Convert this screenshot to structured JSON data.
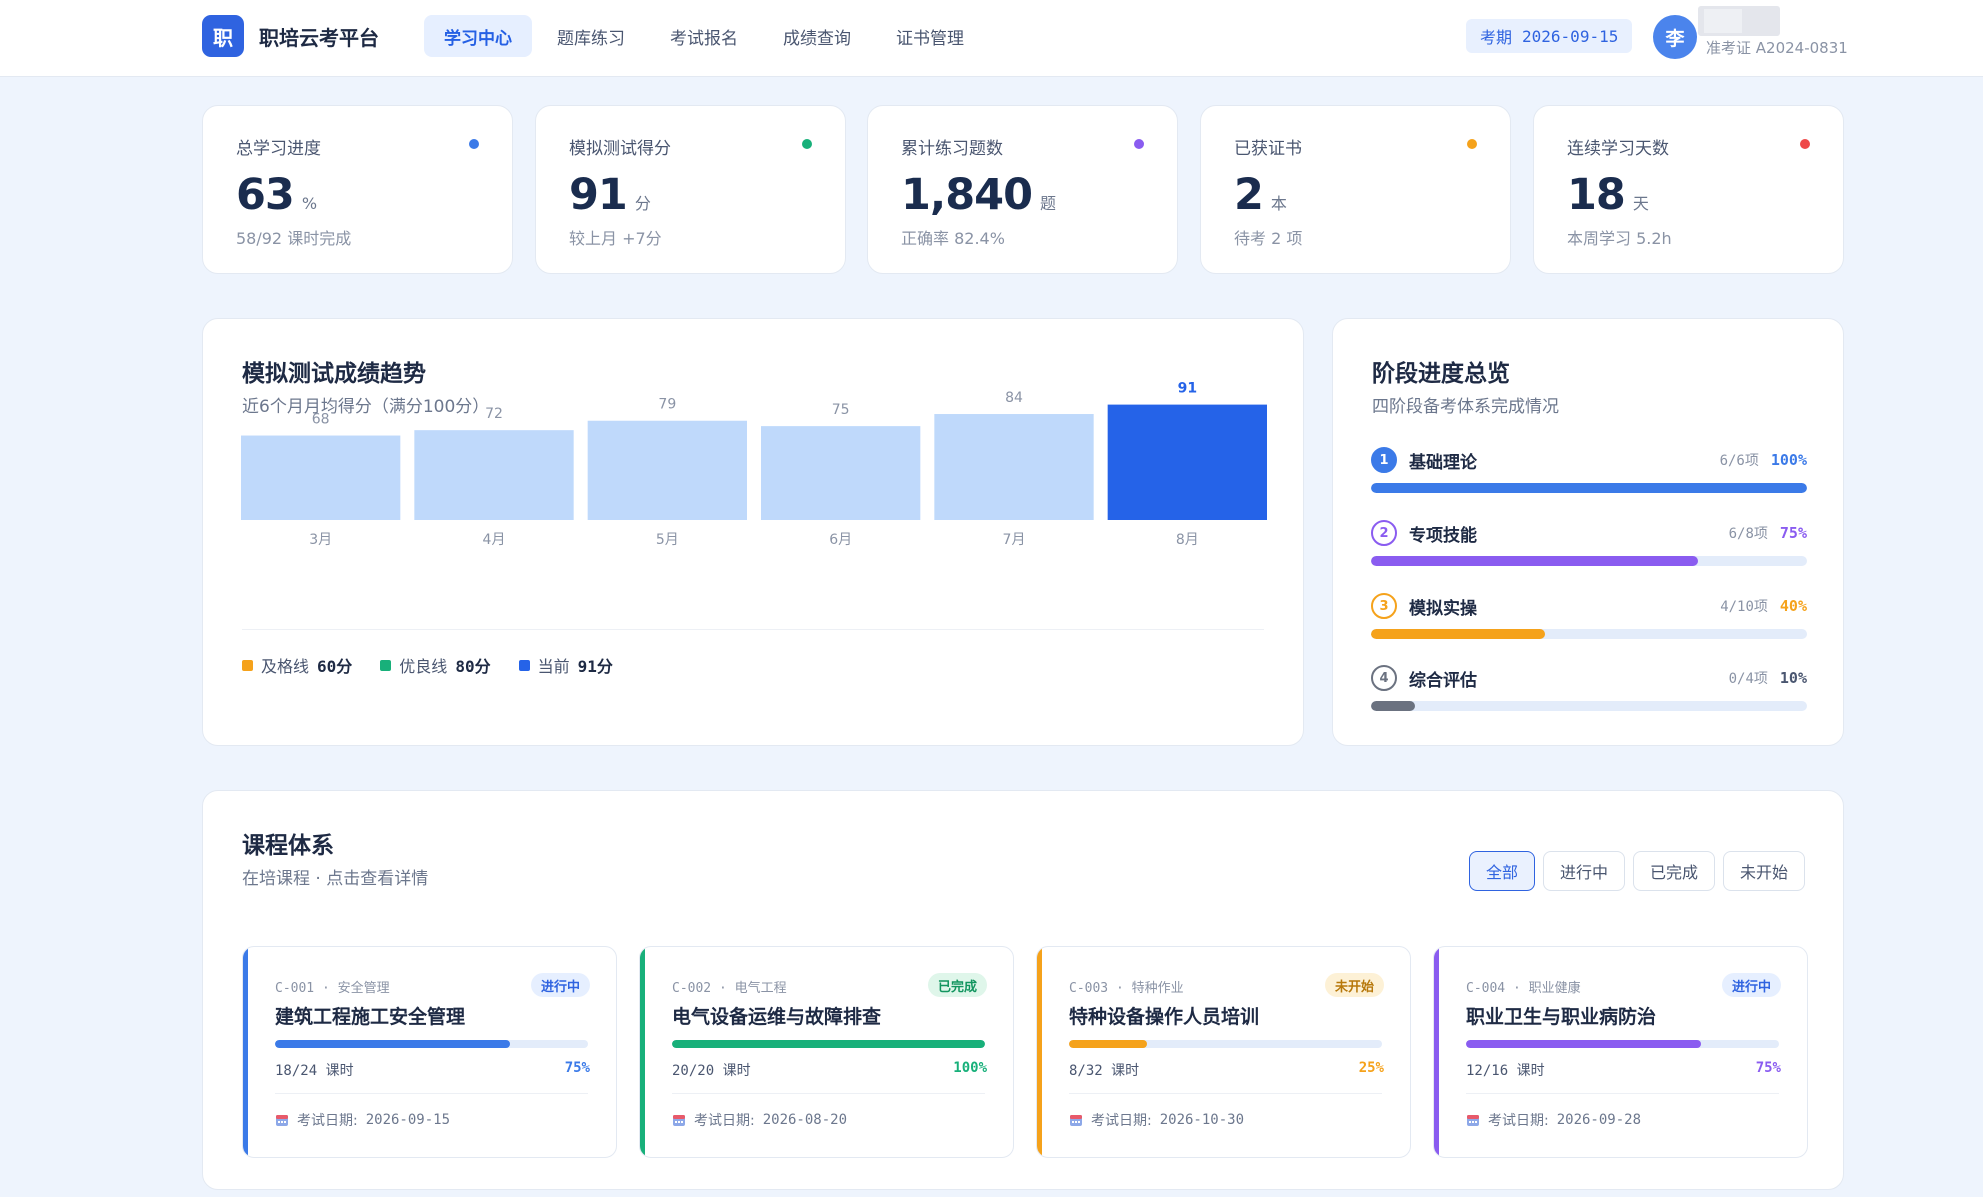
{
  "nav": {
    "logo_char": "职",
    "logo_name": "职培云考平台",
    "tabs": [
      {
        "label": "学习中心"
      },
      {
        "label": "题库练习"
      },
      {
        "label": "考试报名"
      },
      {
        "label": "成绩查询"
      },
      {
        "label": "证书管理"
      }
    ],
    "active_tab": 0,
    "exam_label": "考期",
    "exam_date": "2026-09-15",
    "avatar_char": "李",
    "user_id": "准考证 A2024-0831"
  },
  "stats": [
    {
      "label": "总学习进度",
      "value": "63",
      "unit": "%",
      "sub": "58/92 课时完成",
      "dot_color": "#3b7ae8"
    },
    {
      "label": "模拟测试得分",
      "value": "91",
      "unit": "分",
      "sub": "较上月 +7分",
      "dot_color": "#18b07a"
    },
    {
      "label": "累计练习题数",
      "value": "1,840",
      "unit": "题",
      "sub": "正确率 82.4%",
      "dot_color": "#8a5cf0"
    },
    {
      "label": "已获证书",
      "value": "2",
      "unit": "本",
      "sub": "待考 2 项",
      "dot_color": "#f5a21b"
    },
    {
      "label": "连续学习天数",
      "value": "18",
      "unit": "天",
      "sub": "本周学习 5.2h",
      "dot_color": "#ee4848"
    }
  ],
  "trend": {
    "title": "模拟测试成绩趋势",
    "subtitle": "近6个月月均得分（满分100分）",
    "legend": [
      {
        "label": "及格线",
        "value": "60分",
        "color": "#f5a21b"
      },
      {
        "label": "优良线",
        "value": "80分",
        "color": "#18b07a"
      },
      {
        "label": "当前",
        "value": "91分",
        "color": "#2563e8"
      }
    ]
  },
  "chart_data": {
    "type": "bar",
    "title": "模拟测试成绩趋势",
    "subtitle": "近6个月月均得分（满分100分）",
    "categories": [
      "3月",
      "4月",
      "5月",
      "6月",
      "7月",
      "8月"
    ],
    "values": [
      68,
      72,
      79,
      75,
      84,
      91
    ],
    "highlight_index": 5,
    "colors": {
      "bar": "#bfd9fb",
      "highlight": "#2563e8",
      "label": "#8a93a5",
      "highlight_label": "#2563e8"
    },
    "xlabel": "",
    "ylabel": "",
    "grid": false
  },
  "stages": {
    "title": "阶段进度总览",
    "subtitle": "四阶段备考体系完成情况",
    "items": [
      {
        "num": "1",
        "name": "基础理论",
        "count": "6/6项",
        "pct_label": "100%",
        "pct": 100,
        "color": "#3b7ae8",
        "num_style": "filled"
      },
      {
        "num": "2",
        "name": "专项技能",
        "count": "6/8项",
        "pct_label": "75%",
        "pct": 75,
        "color": "#8a5cf0",
        "num_style": "outline"
      },
      {
        "num": "3",
        "name": "模拟实操",
        "count": "4/10项",
        "pct_label": "40%",
        "pct": 40,
        "color": "#f5a21b",
        "num_style": "outline"
      },
      {
        "num": "4",
        "name": "综合评估",
        "count": "0/4项",
        "pct_label": "10%",
        "pct": 10,
        "color": "#6b7280",
        "num_style": "outline"
      }
    ]
  },
  "courses": {
    "title": "课程体系",
    "subtitle": "在培课程 · 点击查看详情",
    "filters": [
      "全部",
      "进行中",
      "已完成",
      "未开始"
    ],
    "active_filter": 0,
    "date_label": "考试日期:",
    "items": [
      {
        "code": "C-001 · 安全管理",
        "badge": "进行中",
        "badge_bg": "#e6efff",
        "badge_color": "#2f63e0",
        "name": "建筑工程施工安全管理",
        "hours": "18/24 课时",
        "pct_label": "75%",
        "pct": 75,
        "color": "#3b7ae8",
        "date": "2026-09-15"
      },
      {
        "code": "C-002 · 电气工程",
        "badge": "已完成",
        "badge_bg": "#dff6ea",
        "badge_color": "#12955f",
        "name": "电气设备运维与故障排查",
        "hours": "20/20 课时",
        "pct_label": "100%",
        "pct": 100,
        "color": "#18b07a",
        "date": "2026-08-20"
      },
      {
        "code": "C-003 · 特种作业",
        "badge": "未开始",
        "badge_bg": "#fdf1d6",
        "badge_color": "#b7780b",
        "name": "特种设备操作人员培训",
        "hours": "8/32 课时",
        "pct_label": "25%",
        "pct": 25,
        "color": "#f5a21b",
        "date": "2026-10-30"
      },
      {
        "code": "C-004 · 职业健康",
        "badge": "进行中",
        "badge_bg": "#e6efff",
        "badge_color": "#2f63e0",
        "name": "职业卫生与职业病防治",
        "hours": "12/16 课时",
        "pct_label": "75%",
        "pct": 75,
        "color": "#8a5cf0",
        "date": "2026-09-28"
      }
    ]
  }
}
